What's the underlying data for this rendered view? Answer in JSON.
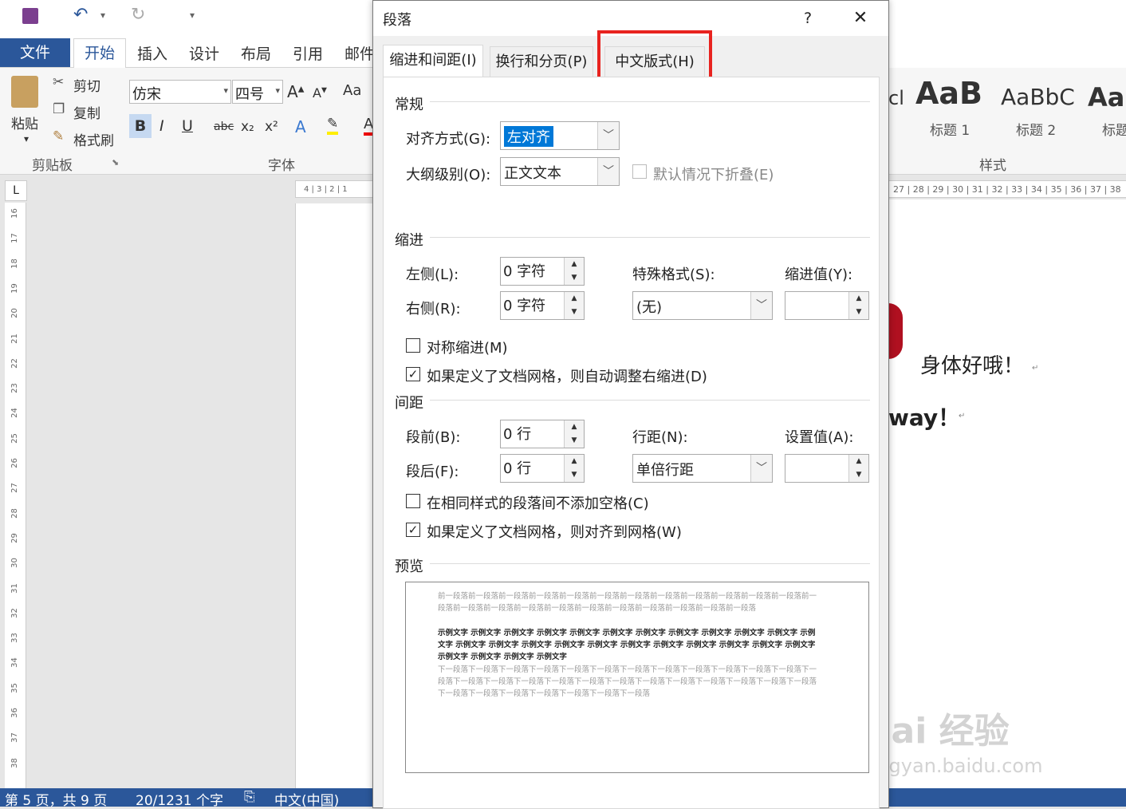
{
  "word": {
    "tabs": {
      "file": "文件",
      "home": "开始",
      "insert": "插入",
      "design": "设计",
      "layout": "布局",
      "references": "引用",
      "mailings": "邮件"
    },
    "clipboard": {
      "paste": "粘贴",
      "cut": "剪切",
      "copy": "复制",
      "format_painter": "格式刷",
      "group": "剪贴板"
    },
    "font": {
      "name": "仿宋",
      "size": "四号",
      "group": "字体",
      "bold": "B",
      "italic": "I",
      "underline": "U",
      "strike": "abc",
      "sub": "x₂",
      "sup": "x²",
      "aa": "Aa"
    },
    "styles": {
      "group": "样式",
      "h1_sample": "AaB",
      "h2_sample": "AaBbC",
      "h3_sample": "AaI",
      "h1": "标题 1",
      "h2": "标题 2",
      "h3": "标题",
      "partial_sample": "cl"
    },
    "ruler_left": "4 | 3 | 2 | 1",
    "ruler_right": "27 | 28 | 29 | 30 | 31 | 32 | 33 | 34 | 35 | 36 | 37 | 38",
    "ruler_v": [
      "16",
      "17",
      "18",
      "19",
      "20",
      "21",
      "22",
      "23",
      "24",
      "25",
      "26",
      "27",
      "28",
      "29",
      "30",
      "31",
      "32",
      "33",
      "34",
      "35",
      "36",
      "37",
      "38"
    ],
    "doc_text1": "身体好哦！",
    "doc_text2": "way！",
    "status": {
      "page": "第 5 页，共 9 页",
      "words": "20/1231 个字",
      "lang": "中文(中国)"
    },
    "watermark": "Bai 经验",
    "watermark_url": "jingyan.baidu.com"
  },
  "dialog": {
    "title": "段落",
    "help": "?",
    "close": "✕",
    "tabs": [
      "缩进和间距(I)",
      "换行和分页(P)",
      "中文版式(H)"
    ],
    "general": {
      "section": "常规",
      "alignment_label": "对齐方式(G):",
      "alignment_value": "左对齐",
      "outline_label": "大纲级别(O):",
      "outline_value": "正文文本",
      "collapse_label": "默认情况下折叠(E)"
    },
    "indent": {
      "section": "缩进",
      "left_label": "左侧(L):",
      "left_value": "0 字符",
      "right_label": "右侧(R):",
      "right_value": "0 字符",
      "special_label": "特殊格式(S):",
      "special_value": "(无)",
      "by_label": "缩进值(Y):",
      "by_value": "",
      "mirror_label": "对称缩进(M)",
      "auto_adjust_label": "如果定义了文档网格，则自动调整右缩进(D)"
    },
    "spacing": {
      "section": "间距",
      "before_label": "段前(B):",
      "before_value": "0 行",
      "after_label": "段后(F):",
      "after_value": "0 行",
      "line_label": "行距(N):",
      "line_value": "单倍行距",
      "at_label": "设置值(A):",
      "at_value": "",
      "no_space_label": "在相同样式的段落间不添加空格(C)",
      "snap_label": "如果定义了文档网格，则对齐到网格(W)"
    },
    "preview": {
      "section": "预览",
      "prev": "前一段落前一段落前一段落前一段落前一段落前一段落前一段落前一段落前一段落前一段落前一段落前一段落前一段落前一段落前一段落前一段落前一段落前一段落前一段落前一段落前一段落前一段落前一段落",
      "sample": "示例文字 示例文字 示例文字 示例文字 示例文字 示例文字 示例文字 示例文字 示例文字 示例文字 示例文字 示例文字 示例文字 示例文字 示例文字 示例文字 示例文字 示例文字 示例文字 示例文字 示例文字 示例文字 示例文字 示例文字 示例文字 示例文字 示例文字",
      "next": "下一段落下一段落下一段落下一段落下一段落下一段落下一段落下一段落下一段落下一段落下一段落下一段落下一段落下一段落下一段落下一段落下一段落下一段落下一段落下一段落下一段落下一段落下一段落下一段落下一段落下一段落下一段落下一段落下一段落下一段落下一段落下一段落"
    }
  }
}
